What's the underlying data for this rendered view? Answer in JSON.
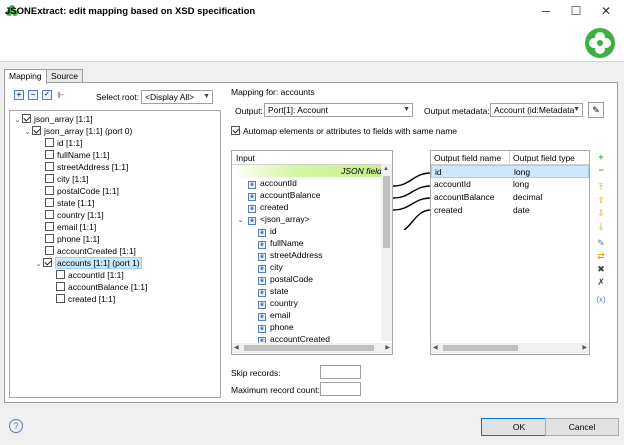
{
  "header": {
    "title": "JSONExtract: edit mapping based on XSD specification"
  },
  "tabs": [
    {
      "label": "Mapping",
      "active": true
    },
    {
      "label": "Source",
      "active": false
    }
  ],
  "tree_toolbar": {
    "select_root_label": "Select root:",
    "select_root_value": "<Display All>"
  },
  "tree": [
    {
      "label": "json_array [1:1]",
      "checked": true,
      "twisty": "⌄"
    },
    {
      "label": "json_array [1:1] (port 0)",
      "checked": true,
      "twisty": "⌄"
    },
    {
      "label": "id [1:1]",
      "checked": false
    },
    {
      "label": "fullName [1:1]",
      "checked": false
    },
    {
      "label": "streetAddress [1:1]",
      "checked": false
    },
    {
      "label": "city [1:1]",
      "checked": false
    },
    {
      "label": "postalCode [1:1]",
      "checked": false
    },
    {
      "label": "state [1:1]",
      "checked": false
    },
    {
      "label": "country [1:1]",
      "checked": false
    },
    {
      "label": "email [1:1]",
      "checked": false
    },
    {
      "label": "phone [1:1]",
      "checked": false
    },
    {
      "label": "accountCreated [1:1]",
      "checked": false
    },
    {
      "label": "accounts [1:1] (port 1)",
      "checked": true,
      "twisty": "⌄",
      "selected": true
    },
    {
      "label": "accountId [1:1]",
      "checked": false
    },
    {
      "label": "accountBalance [1:1]",
      "checked": false
    },
    {
      "label": "created [1:1]",
      "checked": false
    }
  ],
  "mapping": {
    "section_label": "Mapping for: accounts",
    "output_label": "Output:",
    "output_value": "Port[1]: Account",
    "output_metadata_label": "Output metadata:",
    "output_metadata_value": "Account (id:Metadata",
    "automap_label": "Automap elements or attributes to fields with same name",
    "automap_checked": true
  },
  "input_panel": {
    "header": "Input",
    "group_label": "JSON fields",
    "fields": [
      {
        "label": "accountId",
        "icon": "e"
      },
      {
        "label": "accountBalance",
        "icon": "e"
      },
      {
        "label": "created",
        "icon": "e"
      },
      {
        "label": "<json_array>",
        "icon": "e",
        "twisty": "⌄"
      },
      {
        "label": "id",
        "icon": "e"
      },
      {
        "label": "fullName",
        "icon": "e"
      },
      {
        "label": "streetAddress",
        "icon": "e"
      },
      {
        "label": "city",
        "icon": "e"
      },
      {
        "label": "postalCode",
        "icon": "e"
      },
      {
        "label": "state",
        "icon": "e"
      },
      {
        "label": "country",
        "icon": "e"
      },
      {
        "label": "email",
        "icon": "e"
      },
      {
        "label": "phone",
        "icon": "e"
      },
      {
        "label": "accountCreated",
        "icon": "e"
      }
    ]
  },
  "output_panel": {
    "col_name": "Output field name",
    "col_type": "Output field type",
    "rows": [
      {
        "name": "id",
        "type": "long",
        "selected": true
      },
      {
        "name": "accountId",
        "type": "long"
      },
      {
        "name": "accountBalance",
        "type": "decimal"
      },
      {
        "name": "created",
        "type": "date"
      }
    ]
  },
  "side_buttons": [
    "add-icon",
    "remove-icon",
    "move-top-icon",
    "move-up-icon",
    "move-down-icon",
    "move-bottom-icon",
    "edit-icon",
    "auto-map-icon",
    "delete-mapping-icon",
    "delete-all-icon",
    "expression-icon"
  ],
  "skip_records_label": "Skip records:",
  "skip_records_value": "",
  "max_record_count_label": "Maximum record count:",
  "max_record_count_value": "",
  "footer": {
    "ok_label": "OK",
    "cancel_label": "Cancel",
    "help_icon": "?"
  },
  "colors": {
    "accent_green": "#3cb043",
    "selection": "#cce8ff"
  }
}
